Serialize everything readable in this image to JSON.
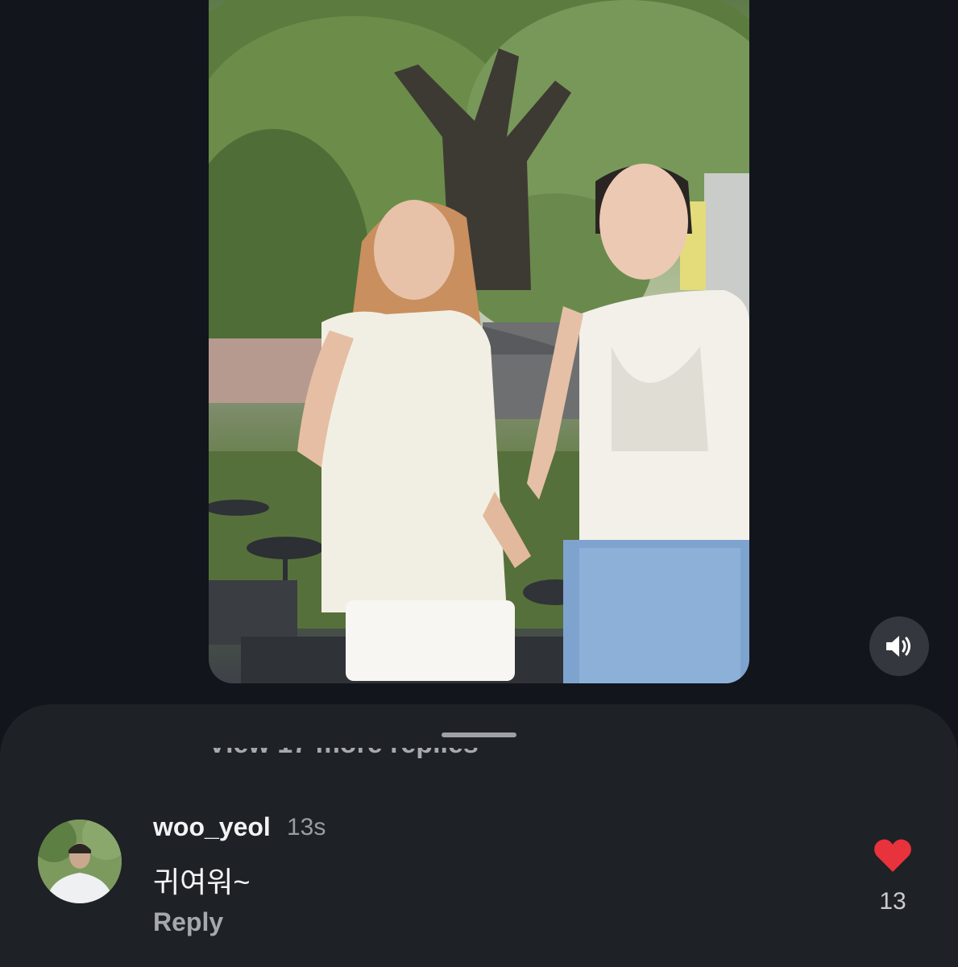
{
  "video": {
    "sound_icon": "speaker-volume-icon"
  },
  "comments_sheet": {
    "view_more_replies": "View 17 more replies",
    "comment": {
      "username": "woo_yeol",
      "timestamp": "13s",
      "text": "귀여워~",
      "reply_label": "Reply",
      "like_count": "13",
      "like_icon": "heart-icon",
      "like_color": "#e8323c"
    }
  },
  "colors": {
    "background": "#12151b",
    "sheet": "#1e2126",
    "accent_like": "#e8323c"
  }
}
